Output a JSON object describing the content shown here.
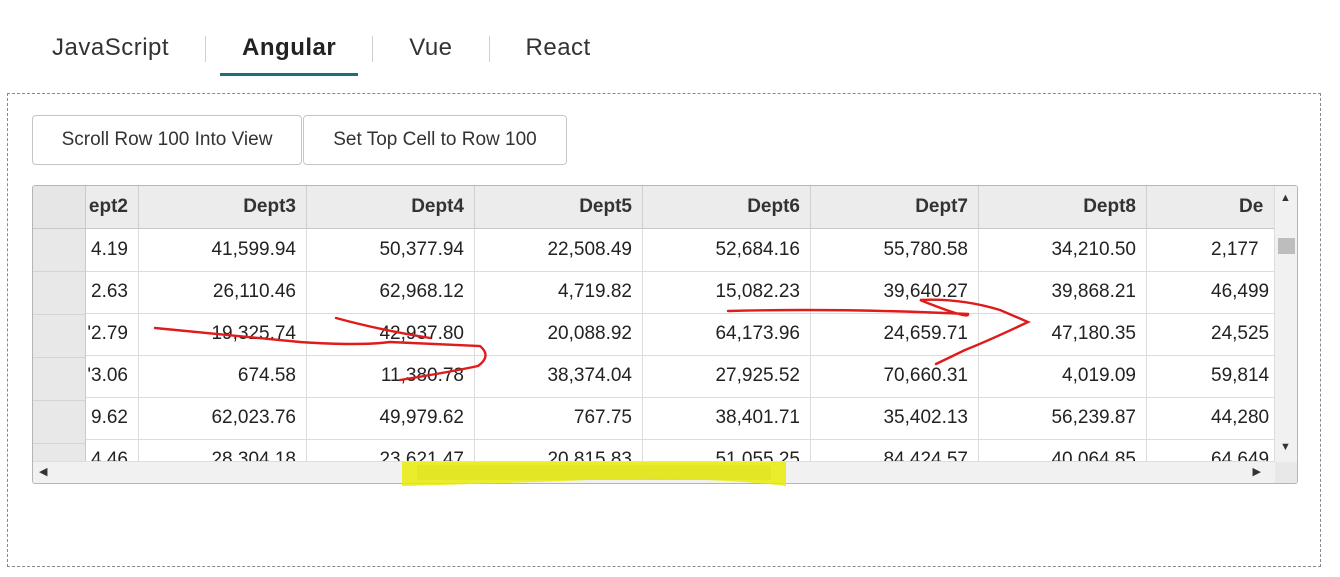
{
  "tabs": [
    {
      "label": "JavaScript"
    },
    {
      "label": "Angular",
      "active": true
    },
    {
      "label": "Vue"
    },
    {
      "label": "React"
    }
  ],
  "buttons": {
    "scroll_row": "Scroll Row 100 Into View",
    "set_top": "Set Top Cell to Row 100"
  },
  "grid": {
    "columns": [
      "ept2",
      "Dept3",
      "Dept4",
      "Dept5",
      "Dept6",
      "Dept7",
      "Dept8",
      "De"
    ],
    "rows": [
      [
        " 4.19",
        "41,599.94",
        "50,377.94",
        "22,508.49",
        "52,684.16",
        "55,780.58",
        "34,210.50",
        "2,177"
      ],
      [
        "2.63",
        "26,110.46",
        "62,968.12",
        "4,719.82",
        "15,082.23",
        "39,640.27",
        "39,868.21",
        "46,499"
      ],
      [
        "'2.79",
        "19,325.74",
        "42,937.80",
        "20,088.92",
        "64,173.96",
        "24,659.71",
        "47,180.35",
        "24,525"
      ],
      [
        "'3.06",
        "674.58",
        "11,380.78",
        "38,374.04",
        "27,925.52",
        "70,660.31",
        "4,019.09",
        "59,814"
      ],
      [
        "9.62",
        "62,023.76",
        "49,979.62",
        "767.75",
        "38,401.71",
        "35,402.13",
        "56,239.87",
        "44,280"
      ],
      [
        "4.46",
        "28,304.18",
        "23,621.47",
        "20,815.83",
        "51,055.25",
        "84,424.57",
        "40,064.85",
        "64,649"
      ]
    ]
  },
  "colors": {
    "tab_underline": "#1f6f78",
    "annotation_red": "#e01b1b",
    "highlight_yellow": "#e6ec00"
  },
  "icons": [
    "scroll-up-icon",
    "scroll-down-icon",
    "scroll-left-icon",
    "scroll-right-icon"
  ]
}
